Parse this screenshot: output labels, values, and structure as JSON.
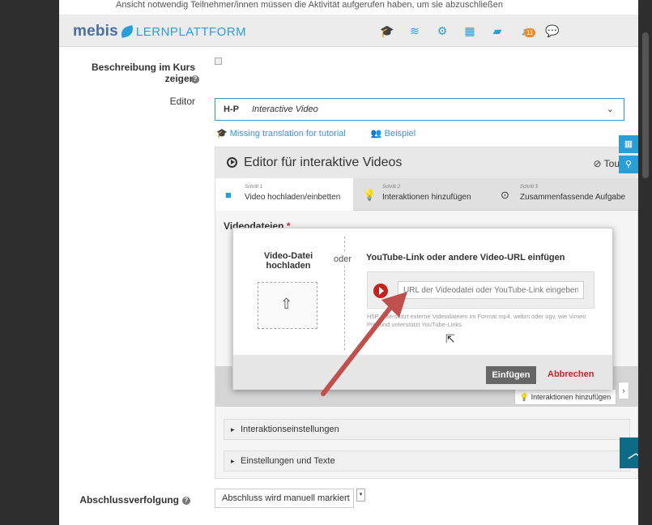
{
  "header": {
    "logo_main": "mebis",
    "logo_sub": "LERNPLATTFORM",
    "notif_count": "11",
    "icons": [
      "graduation-cap-icon",
      "courses-icon",
      "gear-icon",
      "dashboard-icon",
      "folder-icon",
      "bell-icon",
      "chat-icon"
    ]
  },
  "top_hidden_text": "Ansicht notwendig    Teilnehmer/innen müssen die Aktivität aufgerufen haben, um sie abzuschließen",
  "form": {
    "desc_label": "Beschreibung im Kurs zeigen",
    "editor_label": "Editor",
    "editor_h5p": "H-P",
    "editor_value": "Interactive Video",
    "link_tutorial": "Missing translation for tutorial",
    "link_example": "Beispiel",
    "completion_label": "Abschlussverfolgung",
    "completion_value": "Abschluss wird manuell markiert"
  },
  "editor": {
    "title": "Editor für interaktive Videos",
    "tour": "Tour",
    "steps": [
      {
        "num": "Schritt 1",
        "title": "Video hochladen/einbetten"
      },
      {
        "num": "Schritt 2",
        "title": "Interaktionen hinzufügen"
      },
      {
        "num": "Schritt 3",
        "title": "Zusammenfassende Aufgabe"
      }
    ],
    "videos_label": "Videodateien",
    "required_mark": "*",
    "add_interactions_btn": "Interaktionen hinzufügen",
    "accordion": [
      "Interaktionseinstellungen",
      "Einstellungen und Texte"
    ]
  },
  "modal": {
    "upload_label": "Video-Datei hochladen",
    "or": "oder",
    "youtube_label": "YouTube-Link oder andere Video-URL einfügen",
    "url_placeholder": "URL der Videodatei oder YouTube-Link eingeben",
    "hint": "H5P unterstützt externe Videodateien im Format mp4, webm oder ogv, wie Vimeo Pro, und unterstützt YouTube-Links.",
    "insert_btn": "Einfügen",
    "cancel_btn": "Abbrechen"
  },
  "colors": {
    "accent": "#2a9fd6",
    "cancel": "#c62828",
    "arrow": "#c0504d"
  }
}
